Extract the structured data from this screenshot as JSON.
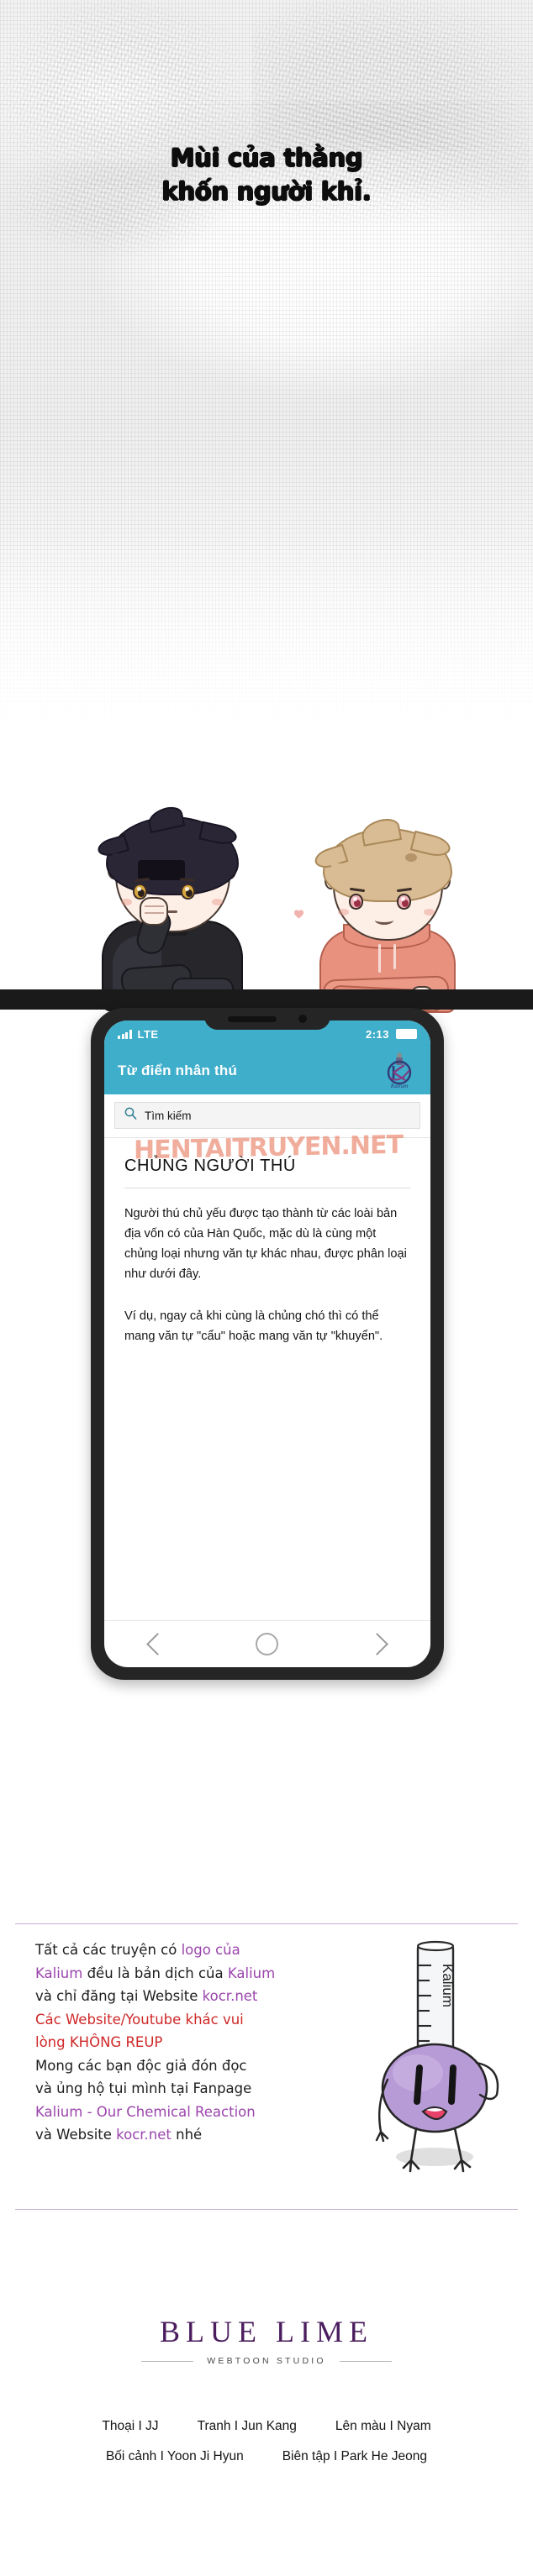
{
  "title_panel": {
    "line1": "Mùi của thằng",
    "line2": "khốn người khỉ."
  },
  "phone": {
    "status": {
      "network": "LTE",
      "time": "2:13",
      "signal_icon": "signal-bars-icon",
      "battery_icon": "battery-full-icon"
    },
    "app_bar": {
      "title": "Từ điển nhân thú",
      "logo_icon": "kalium-logo-icon",
      "bg_color": "#3FAECA"
    },
    "search": {
      "placeholder": "Tìm kiếm",
      "icon": "search-icon"
    },
    "article": {
      "heading": "CHỦNG NGƯỜI THÚ",
      "paragraph1": "Người thú chủ yếu được tạo thành từ các loài bản địa vốn có của Hàn Quốc, mặc dù là cùng một chủng loại nhưng văn tự khác nhau, được phân loại như dưới đây.",
      "paragraph2": "Ví dụ, ngay cả khi cùng là chủng chó thì có thể mang văn tự \"cẩu\" hoặc mang văn tự \"khuyển\"."
    },
    "watermark": "HENTAITRUYEN.NET",
    "nav": {
      "back_icon": "chevron-left-icon",
      "home_icon": "home-circle-icon",
      "forward_icon": "chevron-right-icon"
    }
  },
  "notice": {
    "lines": [
      [
        {
          "t": "Tất cả các truyện có ",
          "c": "k"
        },
        {
          "t": "logo của",
          "c": "p"
        }
      ],
      [
        {
          "t": "Kalium",
          "c": "p"
        },
        {
          "t": " đều là bản dịch của ",
          "c": "k"
        },
        {
          "t": "Kalium",
          "c": "p"
        }
      ],
      [
        {
          "t": "và chỉ đăng tại Website ",
          "c": "k"
        },
        {
          "t": "kocr.net",
          "c": "p"
        }
      ],
      [
        {
          "t": "Các Website/Youtube khác vui",
          "c": "r"
        }
      ],
      [
        {
          "t": "lòng KHÔNG REUP",
          "c": "r"
        }
      ],
      [
        {
          "t": "Mong các bạn độc giả đón đọc",
          "c": "k"
        }
      ],
      [
        {
          "t": "và ủng hộ tụi mình tại Fanpage",
          "c": "k"
        }
      ],
      [
        {
          "t": "Kalium - Our Chemical Reaction",
          "c": "p"
        }
      ],
      [
        {
          "t": "và Website ",
          "c": "k"
        },
        {
          "t": "kocr.net",
          "c": "p"
        },
        {
          "t": " nhé",
          "c": "k"
        }
      ]
    ],
    "mascot": {
      "icon": "kalium-mascot-icon",
      "tube_label": "Kalium"
    },
    "colors": {
      "purple": "#9b45ac",
      "red": "#cf2828",
      "black": "#1d1d1d"
    }
  },
  "studio": {
    "name": "BLUE LIME",
    "subtitle": "WEBTOON STUDIO"
  },
  "credits": {
    "row1": [
      "Thoại I JJ",
      "Tranh I Jun Kang",
      "Lên màu I Nyam"
    ],
    "row2": [
      "Bối cảnh I Yoon Ji Hyun",
      "Biên tập I Park He Jeong"
    ]
  },
  "characters": {
    "left": {
      "name": "dark-haired-character",
      "hair": "#2b2636",
      "outfit": "#26262b"
    },
    "right": {
      "name": "blond-character",
      "hair": "#d9bb94",
      "outfit": "#e8917f"
    },
    "heart_icon": "heart-icon"
  }
}
